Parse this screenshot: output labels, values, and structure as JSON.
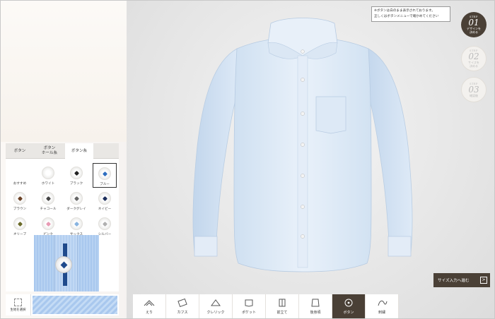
{
  "notice": {
    "line1": "※ボタンは白のまま表示されております。",
    "line2": "正しくはボタンメニューで確かめてください"
  },
  "steps": [
    {
      "label": "STEP",
      "num": "01",
      "text": "デザインを\n決める",
      "active": true
    },
    {
      "label": "STEP",
      "num": "02",
      "text": "サイズを\n決める",
      "active": false
    },
    {
      "label": "STEP",
      "num": "03",
      "text": "確認後",
      "active": false
    }
  ],
  "tabs": [
    "ボタン",
    "ボタン\nホール糸",
    "ボタン糸"
  ],
  "swatches": [
    {
      "label": "おすすめ",
      "color": "",
      "icon": "none"
    },
    {
      "label": "ホワイト",
      "color": "#ffffff",
      "icon": "dot"
    },
    {
      "label": "ブラック",
      "color": "#222222",
      "icon": "cross"
    },
    {
      "label": "ブルー",
      "color": "#2f6fc0",
      "icon": "cross",
      "selected": true
    },
    {
      "label": "ブラウン",
      "color": "#6b4226",
      "icon": "cross"
    },
    {
      "label": "チャコール",
      "color": "#444444",
      "icon": "cross"
    },
    {
      "label": "ダークグレイ",
      "color": "#666666",
      "icon": "cross"
    },
    {
      "label": "ネイビー",
      "color": "#1e2f5c",
      "icon": "cross"
    },
    {
      "label": "オリーブ",
      "color": "#6b6b2a",
      "icon": "cross"
    },
    {
      "label": "ピンク",
      "color": "#e89bb4",
      "icon": "cross"
    },
    {
      "label": "サックス",
      "color": "#89b4e0",
      "icon": "cross"
    },
    {
      "label": "シルバー",
      "color": "#b0b0b0",
      "icon": "cross"
    }
  ],
  "fabric_select": "生地を選択",
  "size_button": "サイズ入力へ進む",
  "size_arrow": ">",
  "toolbar": [
    {
      "label": "えり",
      "icon": "collar-icon"
    },
    {
      "label": "カフス",
      "icon": "cuff-icon"
    },
    {
      "label": "クレリック",
      "icon": "cleric-icon"
    },
    {
      "label": "ポケット",
      "icon": "pocket-icon"
    },
    {
      "label": "前立て",
      "icon": "placket-icon"
    },
    {
      "label": "後身頃",
      "icon": "back-body-icon"
    },
    {
      "label": "ボタン",
      "icon": "button-icon",
      "active": true
    },
    {
      "label": "刺繍",
      "icon": "embroidery-icon"
    }
  ]
}
